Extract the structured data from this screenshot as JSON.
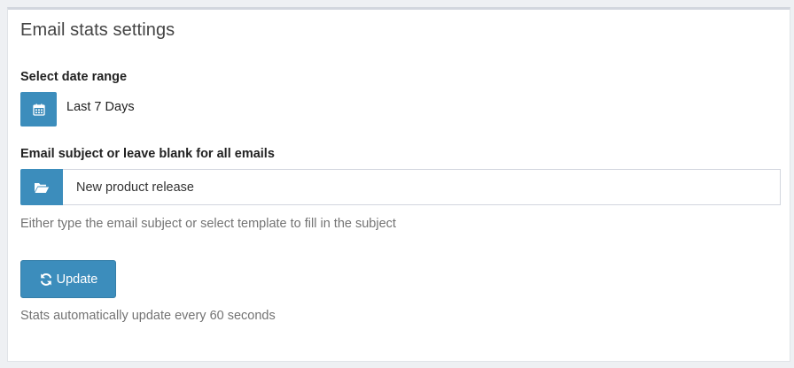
{
  "panel": {
    "title": "Email stats settings"
  },
  "date_range": {
    "label": "Select date range",
    "value": "Last 7 Days",
    "icon": "calendar-icon"
  },
  "subject": {
    "label": "Email subject or leave blank for all emails",
    "value": "New product release",
    "icon": "folder-open-icon",
    "help": "Either type the email subject or select template to fill in the subject"
  },
  "update": {
    "button_label": "Update",
    "icon": "refresh-icon",
    "help": "Stats automatically update every 60 seconds"
  },
  "colors": {
    "accent": "#3c8dbc",
    "accent_border": "#367fa9",
    "panel_border": "#d2d6de",
    "help_text": "#737373"
  }
}
